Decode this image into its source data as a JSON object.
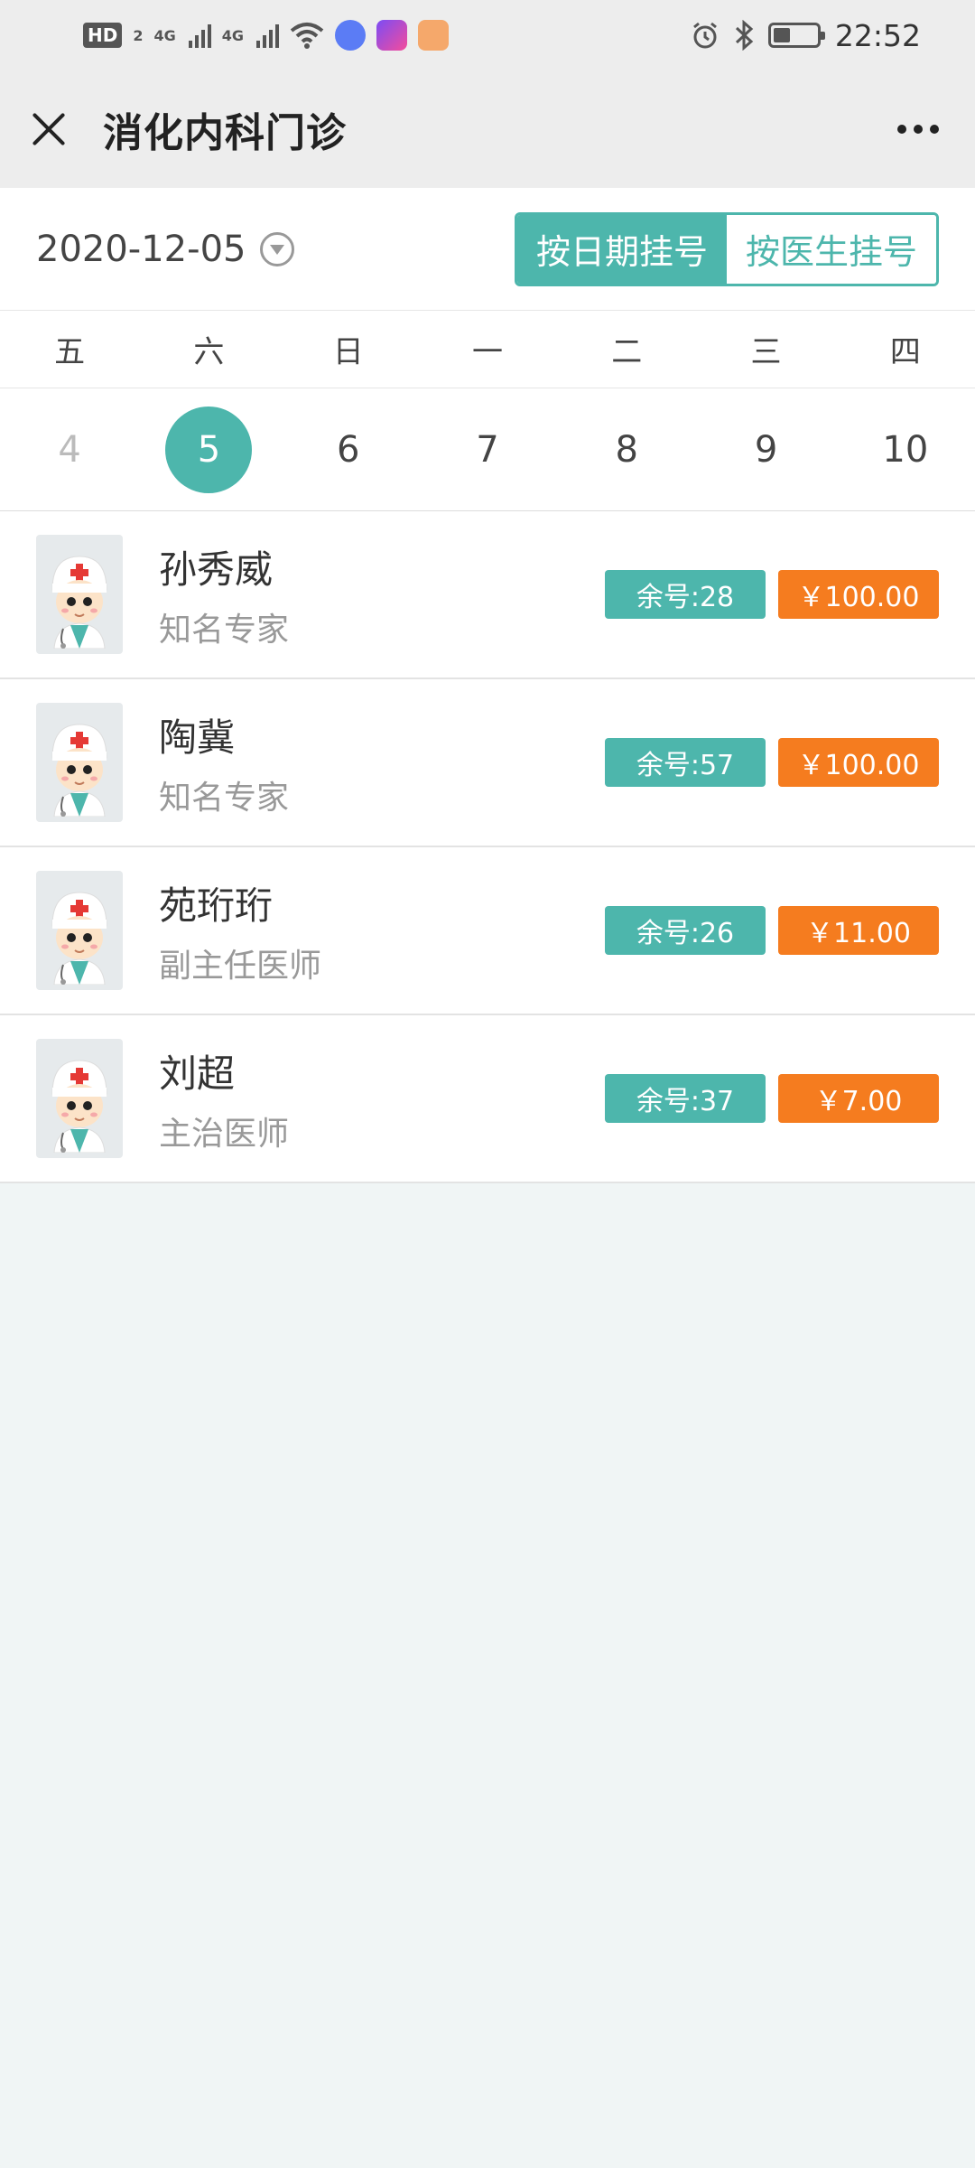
{
  "status_bar": {
    "hd_label": "HD",
    "sim_label": "2",
    "network_1": "4G",
    "network_2": "4G",
    "time": "22:52",
    "icons": [
      "hd-icon",
      "signal-icon",
      "signal-icon",
      "wifi-icon",
      "music-app-icon",
      "honor-app-icon",
      "game-app-icon",
      "alarm-icon",
      "bluetooth-icon",
      "battery-icon"
    ]
  },
  "header": {
    "title": "消化内科门诊"
  },
  "date_bar": {
    "selected_date": "2020-12-05",
    "mode_by_date": "按日期挂号",
    "mode_by_doctor": "按医生挂号"
  },
  "calendar": {
    "weekdays": [
      "五",
      "六",
      "日",
      "一",
      "二",
      "三",
      "四"
    ],
    "days": [
      "4",
      "5",
      "6",
      "7",
      "8",
      "9",
      "10"
    ]
  },
  "doctors": [
    {
      "name": "孙秀威",
      "title": "知名专家",
      "remaining": "余号:28",
      "price": "￥100.00"
    },
    {
      "name": "陶冀",
      "title": "知名专家",
      "remaining": "余号:57",
      "price": "￥100.00"
    },
    {
      "name": "苑珩珩",
      "title": "副主任医师",
      "remaining": "余号:26",
      "price": "￥11.00"
    },
    {
      "name": "刘超",
      "title": "主治医师",
      "remaining": "余号:37",
      "price": "￥7.00"
    }
  ],
  "colors": {
    "accent": "#4db6ac",
    "price": "#f57c1f",
    "background": "#f0f5f5"
  }
}
